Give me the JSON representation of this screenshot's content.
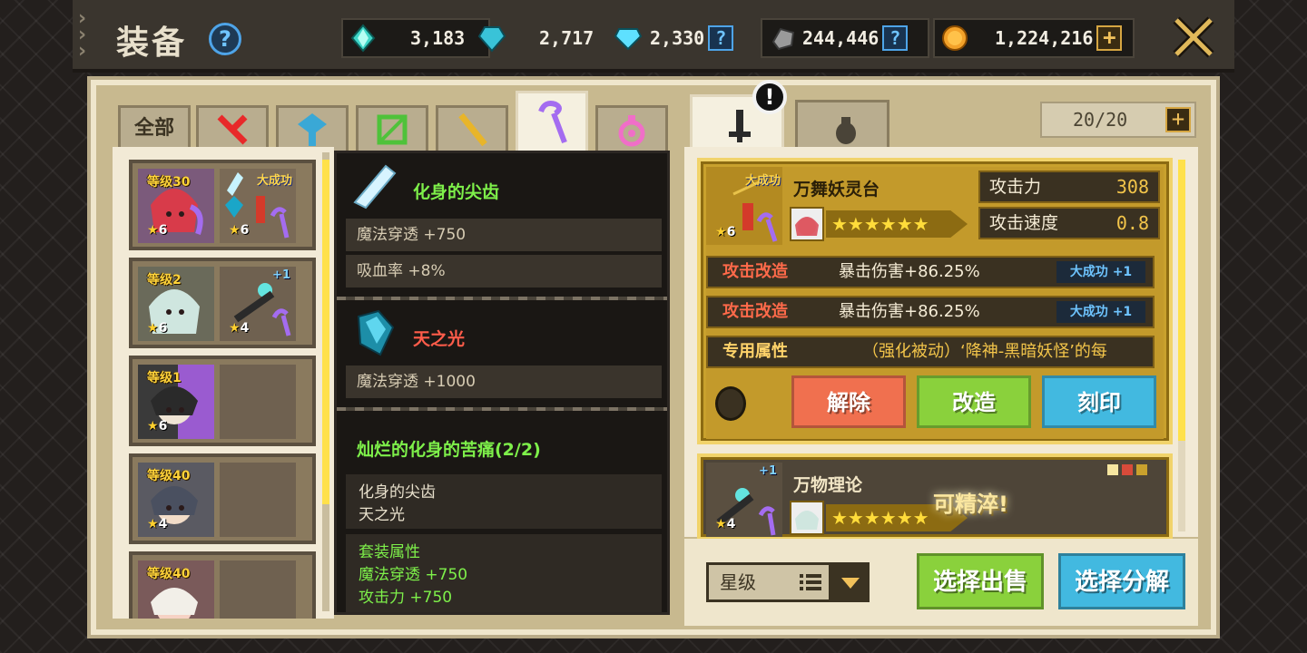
{
  "header": {
    "title": "装备",
    "help": "?",
    "currencies": [
      {
        "value": "3,183",
        "icon": "aqua-crystal-icon"
      },
      {
        "value": "2,717",
        "icon": "cyan-gem-icon"
      },
      {
        "value": "2,330",
        "icon": "blue-diamond-icon",
        "action": "?"
      },
      {
        "value": "244,446",
        "icon": "stone-icon",
        "action": "?"
      },
      {
        "value": "1,224,216",
        "icon": "gold-coin-icon",
        "action": "+"
      }
    ],
    "close_icon": "close-icon"
  },
  "tabs": {
    "all_label": "全部",
    "categories": [
      "sword-icon",
      "hammer-icon",
      "bow-icon",
      "staff-icon",
      "magic-staff-icon",
      "pendant-icon"
    ],
    "active_index": 5
  },
  "equip_list": [
    {
      "level": "等级30",
      "stars": "6",
      "weapon_stars": "6",
      "tag": "大成功"
    },
    {
      "level": "等级2",
      "stars": "6",
      "weapon_stars": "4",
      "tag": "+1"
    },
    {
      "level": "等级1",
      "stars": "6",
      "weapon_stars": "",
      "tag": ""
    },
    {
      "level": "等级40",
      "stars": "4",
      "weapon_stars": "",
      "tag": ""
    },
    {
      "level": "等级40",
      "stars": "",
      "weapon_stars": "",
      "tag": ""
    }
  ],
  "tooltip": {
    "gem1": {
      "name": "化身的尖齿",
      "stats": [
        "魔法穿透 +750",
        "吸血率 +8%"
      ]
    },
    "gem2": {
      "name": "天之光",
      "stats": [
        "魔法穿透 +1000"
      ]
    },
    "set": {
      "title": "灿烂的化身的苦痛(2/2)",
      "items": [
        "化身的尖齿",
        "天之光"
      ],
      "attr_title": "套装属性",
      "attrs": [
        "魔法穿透 +750",
        "攻击力 +750"
      ]
    }
  },
  "right_tabs": {
    "alert": "!",
    "slot_count": "20/20",
    "plus": "+"
  },
  "selected_item": {
    "tag": "大成功",
    "name": "万舞妖灵台",
    "stars": "6",
    "hero_stars": "★★★★★★",
    "attack_label": "攻击力",
    "attack_value": "308",
    "speed_label": "攻击速度",
    "speed_value": "0.8",
    "mods": [
      {
        "key": "攻击改造",
        "value": "暴击伤害+86.25%",
        "badge": "大成功",
        "badge_plus": "+1"
      },
      {
        "key": "攻击改造",
        "value": "暴击伤害+86.25%",
        "badge": "大成功",
        "badge_plus": "+1"
      }
    ],
    "exclusive_key": "专用属性",
    "exclusive_value": "（强化被动）‘降神-黑暗妖怪’的每",
    "buttons": {
      "unequip": "解除",
      "modify": "改造",
      "engrave": "刻印"
    }
  },
  "second_item": {
    "name": "万物理论",
    "plus": "+1",
    "stars": "4",
    "hero_stars": "★★★★★★",
    "refine": "可精淬!"
  },
  "bottom": {
    "sort_label": "星级",
    "sell_btn": "选择出售",
    "dismantle_btn": "选择分解"
  },
  "colors": {
    "gold": "#c9a12d",
    "green_btn": "#8ad13c",
    "blue_btn": "#42b9e0",
    "red_btn": "#f0704f",
    "set_green": "#7ef04a"
  }
}
